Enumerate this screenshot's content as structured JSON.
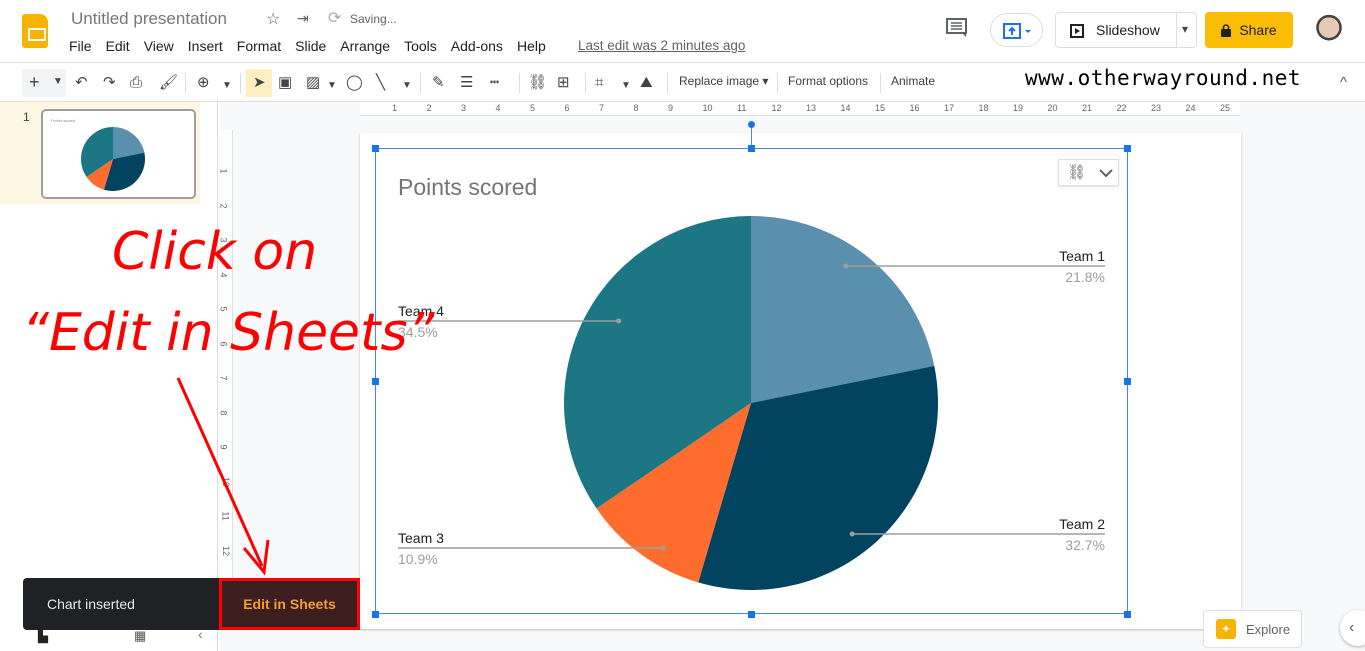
{
  "header": {
    "title": "Untitled presentation",
    "saving_status": "Saving...",
    "menu": [
      "File",
      "Edit",
      "View",
      "Insert",
      "Format",
      "Slide",
      "Arrange",
      "Tools",
      "Add-ons",
      "Help"
    ],
    "last_edit": "Last edit was 2 minutes ago",
    "slideshow_label": "Slideshow",
    "share_label": "Share",
    "icons": {
      "star": "☆",
      "move": "⇥",
      "sync": "⟳",
      "comment": "▤",
      "present": "↑",
      "play": "▶",
      "lock": "🔒",
      "caret": "▾"
    }
  },
  "toolbar": {
    "replace_image": "Replace image",
    "format_options": "Format options",
    "animate": "Animate",
    "watermark": "www.otherwayround.net"
  },
  "filmstrip": {
    "slides": [
      {
        "number": "1",
        "title": "Points scored"
      }
    ]
  },
  "rulers": {
    "horizontal": [
      "1",
      "2",
      "3",
      "4",
      "5",
      "6",
      "7",
      "8",
      "9",
      "10",
      "11",
      "12",
      "13",
      "14",
      "15",
      "16",
      "17",
      "18",
      "19",
      "20",
      "21",
      "22",
      "23",
      "24",
      "25"
    ],
    "vertical": [
      "1",
      "2",
      "3",
      "4",
      "5",
      "6",
      "7",
      "8",
      "9",
      "10",
      "11",
      "12"
    ]
  },
  "chart_data": {
    "type": "pie",
    "title": "Points scored",
    "categories": [
      "Team 1",
      "Team 2",
      "Team 3",
      "Team 4"
    ],
    "values": [
      21.8,
      32.7,
      10.9,
      34.5
    ],
    "labels": [
      "21.8%",
      "32.7%",
      "10.9%",
      "34.5%"
    ],
    "colors": [
      "#5a8fae",
      "#02445f",
      "#ff6d2e",
      "#1d7683"
    ],
    "start_angle_deg": 0,
    "direction": "clockwise",
    "legend": "labeled"
  },
  "annotation": {
    "line1": "Click on",
    "line2": "“Edit in Sheets”",
    "color": "#ff0000"
  },
  "snackbar": {
    "message": "Chart inserted",
    "action": "Edit in Sheets"
  },
  "explore": {
    "label": "Explore"
  }
}
